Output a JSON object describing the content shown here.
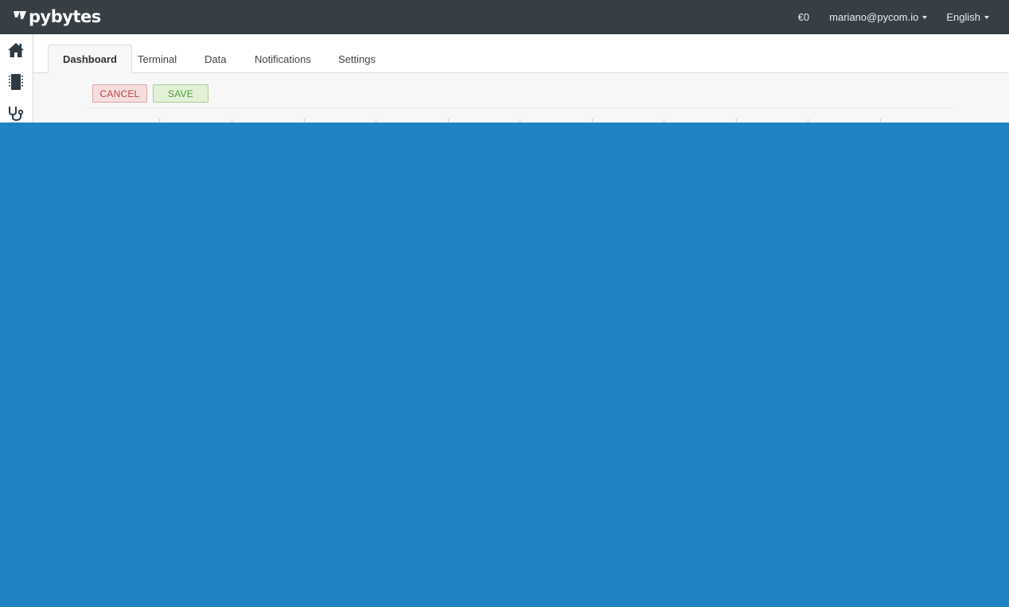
{
  "brand": {
    "name": "pybytes"
  },
  "header": {
    "credit": "€0",
    "user": "mariano@pycom.io",
    "language": "English"
  },
  "sidebar": {
    "items": [
      {
        "icon": "home-icon"
      },
      {
        "icon": "device-icon"
      },
      {
        "icon": "stethoscope-icon"
      }
    ]
  },
  "tabs": [
    {
      "label": "Dashboard",
      "active": true
    },
    {
      "label": "Terminal"
    },
    {
      "label": "Data"
    },
    {
      "label": "Notifications"
    },
    {
      "label": "Settings"
    }
  ],
  "toolbar": {
    "cancel_label": "CANCEL",
    "save_label": "SAVE"
  },
  "colors": {
    "topbar": "#373f44",
    "overlay": "#2083c2",
    "cancel": "#b44343",
    "save": "#4e9b3b"
  }
}
